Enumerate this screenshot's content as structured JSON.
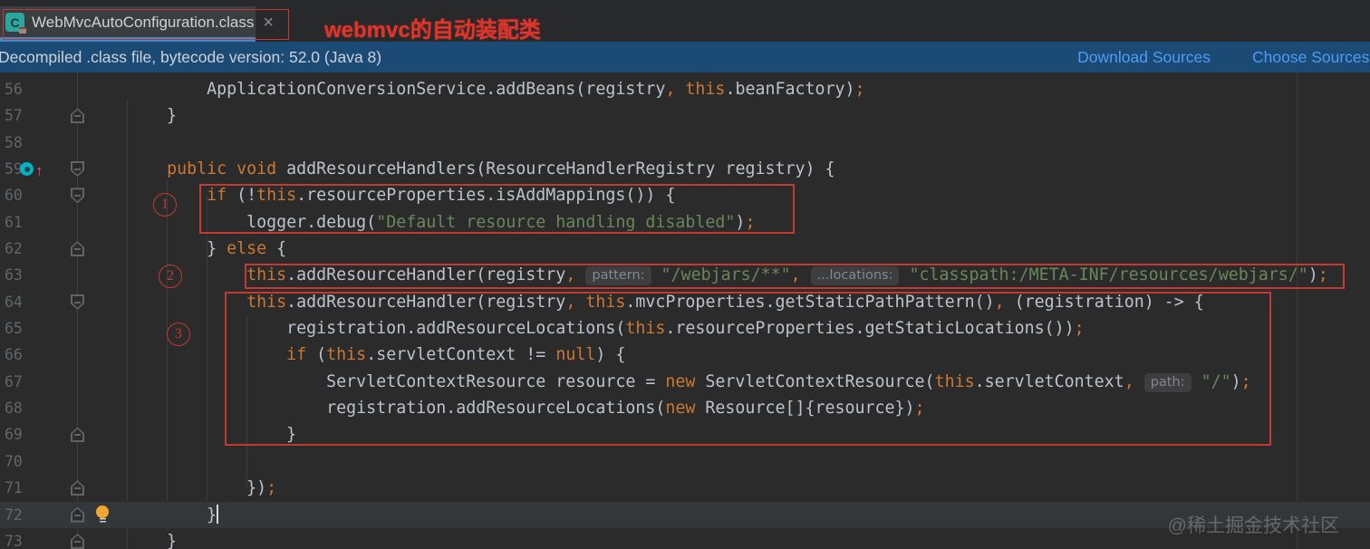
{
  "tab": {
    "title": "WebMvcAutoConfiguration.class",
    "icon_letter": "C",
    "close_glyph": "×"
  },
  "banner": {
    "message": "Decompiled .class file, bytecode version: 52.0 (Java 8)",
    "links": [
      "Download Sources",
      "Choose Sources..."
    ]
  },
  "annotations": {
    "title": "webmvc的自动装配类",
    "markers": [
      "1",
      "2",
      "3"
    ]
  },
  "watermark": "@稀土掘金技术社区",
  "colors": {
    "keyword": "#cc7832",
    "string": "#6a8759",
    "text": "#bdc3cc",
    "punct": "#cc7832",
    "line_number": "#61666a",
    "editor_bg": "#2b2b2b",
    "banner_bg": "#1b4a75",
    "link": "#4d9df7",
    "tab_underline": "#4a86c4",
    "annotation": "#c23a31",
    "inlay_text": "#85898d",
    "inlay_bg": "#3c3e40",
    "bulb": "#f0a732",
    "override": "#00b3c6"
  },
  "code": {
    "lines": [
      {
        "num": 56,
        "fold": null,
        "gutter": null,
        "tokens": [
          [
            "d",
            "            ApplicationConversionService.addBeans(registry"
          ],
          [
            "pun",
            ","
          ],
          [
            "d",
            " "
          ],
          [
            "kw",
            "this"
          ],
          [
            "d",
            ".beanFactory)"
          ],
          [
            "pun",
            ";"
          ]
        ]
      },
      {
        "num": 57,
        "fold": "up",
        "gutter": null,
        "tokens": [
          [
            "d",
            "        }"
          ]
        ]
      },
      {
        "num": 58,
        "fold": null,
        "gutter": null,
        "tokens": []
      },
      {
        "num": 59,
        "fold": "down",
        "gutter": "override",
        "tokens": [
          [
            "d",
            "        "
          ],
          [
            "kw",
            "public"
          ],
          [
            "d",
            " "
          ],
          [
            "kw",
            "void"
          ],
          [
            "d",
            " addResourceHandlers(ResourceHandlerRegistry registry) {"
          ]
        ]
      },
      {
        "num": 60,
        "fold": "down",
        "gutter": null,
        "tokens": [
          [
            "d",
            "            "
          ],
          [
            "kw",
            "if"
          ],
          [
            "d",
            " (!"
          ],
          [
            "kw",
            "this"
          ],
          [
            "d",
            ".resourceProperties.isAddMappings()) {"
          ]
        ]
      },
      {
        "num": 61,
        "fold": null,
        "gutter": null,
        "tokens": [
          [
            "d",
            "                logger.debug("
          ],
          [
            "str",
            "\"Default resource handling disabled\""
          ],
          [
            "d",
            ")"
          ],
          [
            "pun",
            ";"
          ]
        ]
      },
      {
        "num": 62,
        "fold": "up",
        "gutter": null,
        "tokens": [
          [
            "d",
            "            } "
          ],
          [
            "kw",
            "else"
          ],
          [
            "d",
            " {"
          ]
        ]
      },
      {
        "num": 63,
        "fold": null,
        "gutter": null,
        "tokens": [
          [
            "d",
            "                "
          ],
          [
            "kw",
            "this"
          ],
          [
            "d",
            ".addResourceHandler(registry"
          ],
          [
            "pun",
            ","
          ],
          [
            "d",
            " "
          ],
          [
            "inlay",
            "pattern:"
          ],
          [
            "d",
            " "
          ],
          [
            "str",
            "\"/webjars/**\""
          ],
          [
            "pun",
            ","
          ],
          [
            "d",
            " "
          ],
          [
            "inlay",
            "...locations:"
          ],
          [
            "d",
            " "
          ],
          [
            "str",
            "\"classpath:/META-INF/resources/webjars/\""
          ],
          [
            "d",
            ")"
          ],
          [
            "pun",
            ";"
          ]
        ]
      },
      {
        "num": 64,
        "fold": "down",
        "gutter": null,
        "tokens": [
          [
            "d",
            "                "
          ],
          [
            "kw",
            "this"
          ],
          [
            "d",
            ".addResourceHandler(registry"
          ],
          [
            "pun",
            ","
          ],
          [
            "d",
            " "
          ],
          [
            "kw",
            "this"
          ],
          [
            "d",
            ".mvcProperties.getStaticPathPattern()"
          ],
          [
            "pun",
            ","
          ],
          [
            "d",
            " (registration) -> {"
          ]
        ]
      },
      {
        "num": 65,
        "fold": null,
        "gutter": null,
        "tokens": [
          [
            "d",
            "                    registration.addResourceLocations("
          ],
          [
            "kw",
            "this"
          ],
          [
            "d",
            ".resourceProperties.getStaticLocations())"
          ],
          [
            "pun",
            ";"
          ]
        ]
      },
      {
        "num": 66,
        "fold": null,
        "gutter": null,
        "tokens": [
          [
            "d",
            "                    "
          ],
          [
            "kw",
            "if"
          ],
          [
            "d",
            " ("
          ],
          [
            "kw",
            "this"
          ],
          [
            "d",
            ".servletContext != "
          ],
          [
            "kw",
            "null"
          ],
          [
            "d",
            ") {"
          ]
        ]
      },
      {
        "num": 67,
        "fold": null,
        "gutter": null,
        "tokens": [
          [
            "d",
            "                        ServletContextResource resource = "
          ],
          [
            "kw",
            "new"
          ],
          [
            "d",
            " ServletContextResource("
          ],
          [
            "kw",
            "this"
          ],
          [
            "d",
            ".servletContext"
          ],
          [
            "pun",
            ","
          ],
          [
            "d",
            " "
          ],
          [
            "inlay",
            "path:"
          ],
          [
            "d",
            " "
          ],
          [
            "str",
            "\"/\""
          ],
          [
            "d",
            ")"
          ],
          [
            "pun",
            ";"
          ]
        ]
      },
      {
        "num": 68,
        "fold": null,
        "gutter": null,
        "tokens": [
          [
            "d",
            "                        registration.addResourceLocations("
          ],
          [
            "kw",
            "new"
          ],
          [
            "d",
            " Resource[]{resource})"
          ],
          [
            "pun",
            ";"
          ]
        ]
      },
      {
        "num": 69,
        "fold": "up",
        "gutter": null,
        "tokens": [
          [
            "d",
            "                    }"
          ]
        ]
      },
      {
        "num": 70,
        "fold": null,
        "gutter": null,
        "tokens": []
      },
      {
        "num": 71,
        "fold": "up",
        "gutter": null,
        "tokens": [
          [
            "d",
            "                })"
          ],
          [
            "pun",
            ";"
          ]
        ]
      },
      {
        "num": 72,
        "fold": "up",
        "gutter": "bulb",
        "current": true,
        "cursor": true,
        "tokens": [
          [
            "d",
            "            }"
          ]
        ]
      },
      {
        "num": 73,
        "fold": "up",
        "gutter": null,
        "tokens": [
          [
            "d",
            "        }"
          ]
        ]
      }
    ]
  }
}
